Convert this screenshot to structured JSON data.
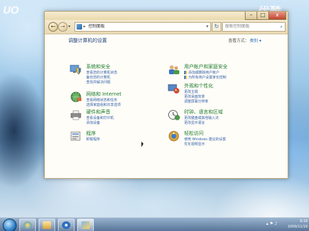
{
  "watermark": {
    "left_text": "UO",
    "right_text": "优酷",
    "play_glyph": "▶"
  },
  "window": {
    "caption_buttons": {
      "minimize": "–",
      "maximize": "□",
      "close": "x"
    },
    "nav": {
      "back_glyph": "←",
      "forward_glyph": "→",
      "dropdown_glyph": "▾"
    },
    "address": {
      "separator": "▸",
      "path": "控制面板",
      "dropdown_glyph": "▾"
    },
    "refresh_glyph": "↻",
    "search": {
      "placeholder": "搜索控制面板",
      "icon": "search-icon",
      "glyph": "⌕"
    },
    "heading": "调整计算机的设置",
    "view_by_label": "查看方式：",
    "view_by_value": "类别 ▾",
    "categories": [
      {
        "id": "system-security",
        "icon": "shield-computer-icon",
        "title": "系统和安全",
        "links": [
          "查看您的计算机状态",
          "备份您的计算机",
          "查找并解决问题"
        ]
      },
      {
        "id": "network-internet",
        "icon": "globe-network-icon",
        "title": "网络和 Internet",
        "links": [
          "查看网络状态和任务",
          "选择家庭组和共享选项"
        ]
      },
      {
        "id": "hardware-sound",
        "icon": "printer-icon",
        "title": "硬件和声音",
        "links": [
          "查看设备和打印机",
          "添加设备"
        ]
      },
      {
        "id": "programs",
        "icon": "programs-icon",
        "title": "程序",
        "links": [
          "卸载程序"
        ]
      },
      {
        "id": "user-accounts",
        "icon": "users-icon",
        "title": "用户帐户和家庭安全",
        "links": [
          "添加或删除用户帐户",
          "为所有用户设置家长控制"
        ]
      },
      {
        "id": "appearance",
        "icon": "appearance-icon",
        "title": "外观和个性化",
        "links": [
          "更改主题",
          "更改桌面背景",
          "调整屏幕分辨率"
        ]
      },
      {
        "id": "clock-language",
        "icon": "clock-globe-icon",
        "title": "时钟、语言和区域",
        "links": [
          "更改键盘或其他输入法",
          "更改显示语言"
        ]
      },
      {
        "id": "ease-access",
        "icon": "ease-of-access-icon",
        "title": "轻松访问",
        "links": [
          "使用 Windows 建议的设置",
          "优化视频显示"
        ]
      }
    ]
  },
  "taskbar": {
    "buttons": [
      {
        "id": "ie",
        "icon": "internet-explorer-icon"
      },
      {
        "id": "folder",
        "icon": "folder-icon"
      },
      {
        "id": "media",
        "icon": "media-player-icon"
      },
      {
        "id": "control-panel",
        "icon": "control-panel-icon"
      }
    ],
    "tray_glyphs": "▴ ⚑ ♪",
    "time": "9:18",
    "date": "2009/11/19"
  },
  "colors": {
    "category_title": "#1a7a2a",
    "link": "#2f5fa8",
    "heading": "#1e3f78"
  }
}
